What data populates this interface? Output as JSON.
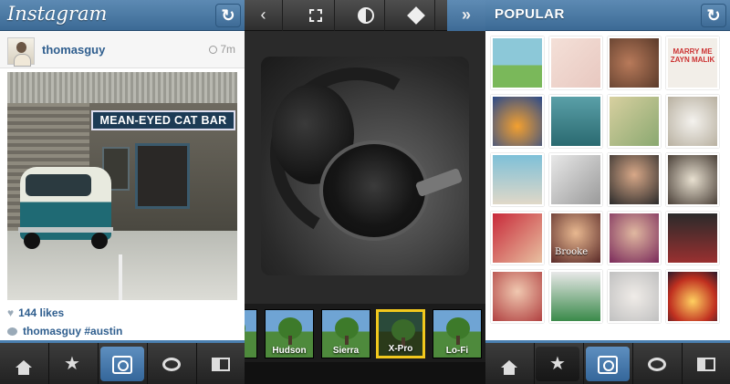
{
  "feed": {
    "app_title": "Instagram",
    "refresh_icon": "refresh-icon",
    "post": {
      "username": "thomasguy",
      "time": "7m",
      "photo_sign": "MEAN-EYED CAT BAR",
      "likes": "144 likes",
      "caption_user": "thomasguy",
      "caption_tag": "#austin"
    }
  },
  "editor": {
    "tools": [
      {
        "name": "back",
        "icon": "chevron-left-icon"
      },
      {
        "name": "border",
        "icon": "border-icon"
      },
      {
        "name": "lux",
        "icon": "lux-icon"
      },
      {
        "name": "rotate",
        "icon": "rotate-icon"
      },
      {
        "name": "next",
        "icon": "double-chevron-right-icon"
      }
    ],
    "filters": [
      "Hudson",
      "Sierra",
      "X-Pro",
      "Lo-Fi"
    ],
    "selected_filter": "X-Pro"
  },
  "popular": {
    "title": "POPULAR",
    "thumb_text_marry": "MARRY ME ZAYN MALIK",
    "thumb_text_brooke": "Brooke"
  },
  "nav": {
    "items": [
      "home-icon",
      "star-icon",
      "camera-icon",
      "comment-icon",
      "news-icon"
    ],
    "active": "camera-icon"
  },
  "colors": {
    "header_blue": "#4a7aa5",
    "link_blue": "#2f5e8e",
    "selected_filter_border": "#f2c81d"
  }
}
